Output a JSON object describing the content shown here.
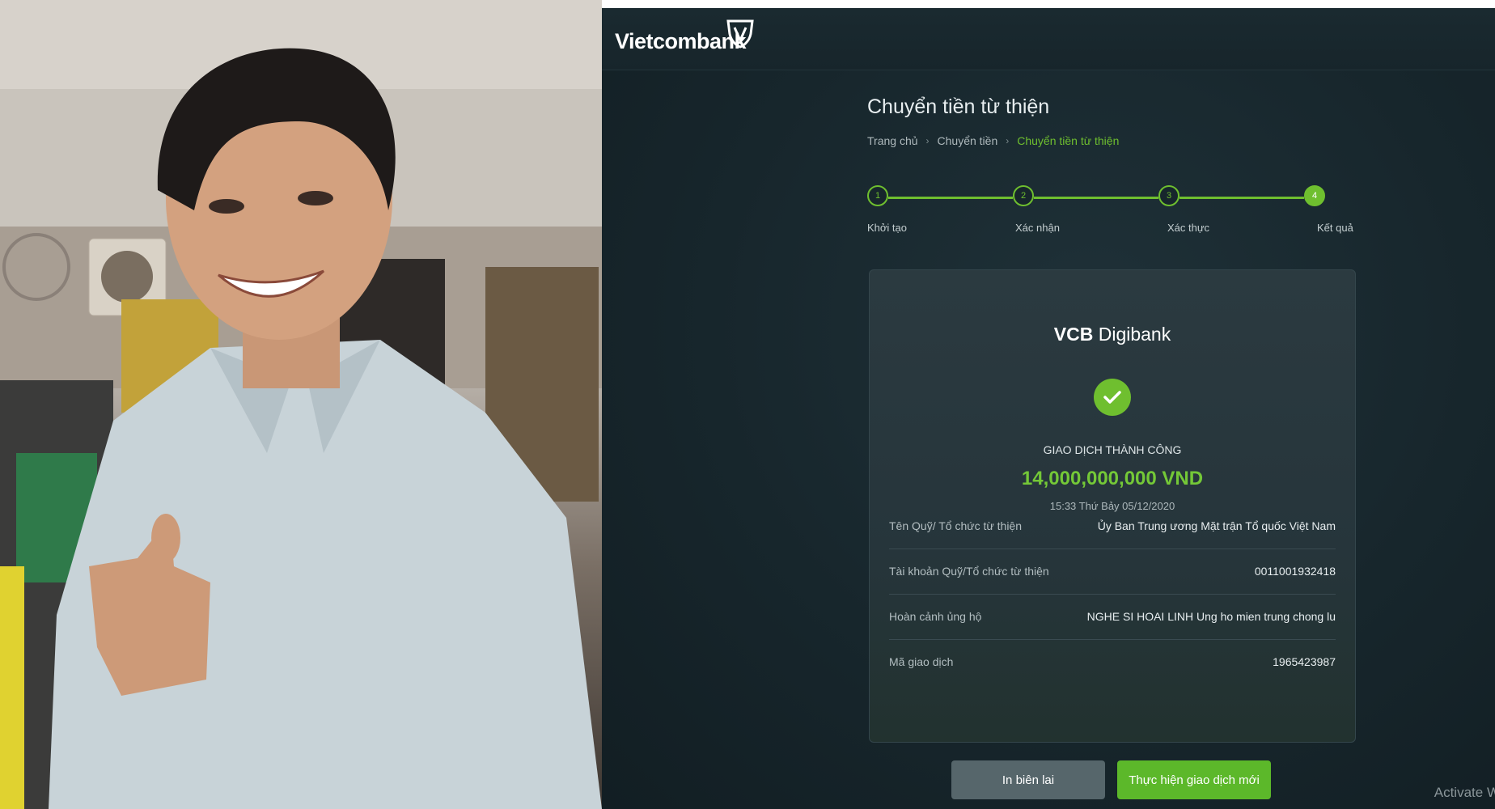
{
  "bank": {
    "logo": "Vietcombank",
    "page_title": "Chuyển tiền từ thiện",
    "breadcrumb": [
      "Trang chủ",
      "Chuyển tiền",
      "Chuyển tiền từ thiện"
    ],
    "steps": [
      {
        "number": "1",
        "label": "Khởi tạo"
      },
      {
        "number": "2",
        "label": "Xác nhận"
      },
      {
        "number": "3",
        "label": "Xác thực"
      },
      {
        "number": "4",
        "label": "Kết quả"
      }
    ],
    "card": {
      "brand_bold": "VCB",
      "brand_light": "Digibank",
      "status": "GIAO DỊCH THÀNH CÔNG",
      "amount": "14,000,000,000 VND",
      "datetime": "15:33 Thứ Bảy 05/12/2020",
      "rows": [
        {
          "label": "Tên Quỹ/ Tổ chức từ thiện",
          "value": "Ủy Ban Trung ương Mặt trận Tổ quốc Việt Nam"
        },
        {
          "label": "Tài khoản Quỹ/Tổ chức từ thiện",
          "value": "0011001932418"
        },
        {
          "label": "Hoàn cảnh ủng hộ",
          "value": "NGHE SI HOAI LINH Ung ho mien trung chong lu"
        },
        {
          "label": "Mã giao dịch",
          "value": "1965423987"
        }
      ]
    },
    "buttons": {
      "print": "In biên lai",
      "new": "Thực hiện giao dịch mới"
    },
    "watermark": "Activate W"
  },
  "colors": {
    "accent_green": "#6fbf2f",
    "background": "#17262c",
    "card": "#2b3a40"
  },
  "icons": {
    "logo_mark": "vietcombank-shield-icon",
    "success": "checkmark-icon"
  }
}
